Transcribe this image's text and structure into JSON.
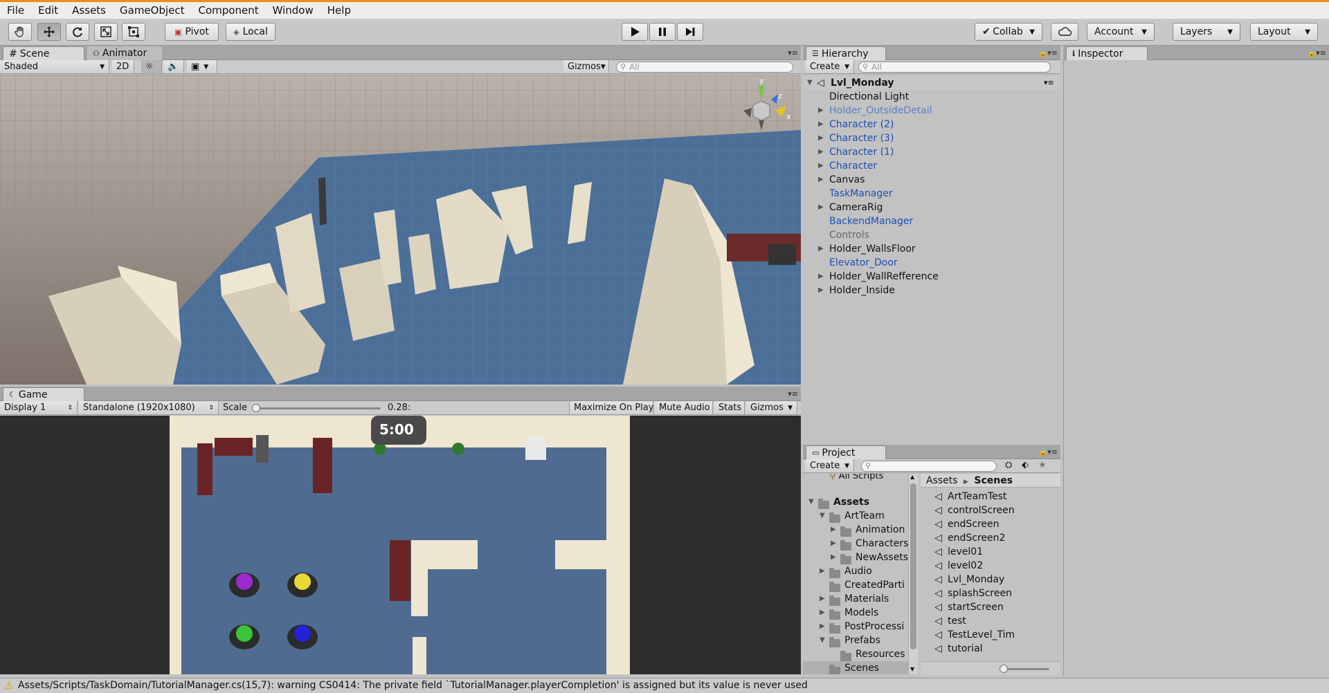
{
  "menu": [
    "File",
    "Edit",
    "Assets",
    "GameObject",
    "Component",
    "Window",
    "Help"
  ],
  "toolbar": {
    "pivot": "Pivot",
    "local": "Local",
    "collab": "Collab",
    "account": "Account",
    "layers": "Layers",
    "layout": "Layout"
  },
  "scene": {
    "tab": "Scene",
    "animator_tab": "Animator",
    "shading": "Shaded",
    "mode_2d": "2D",
    "gizmos": "Gizmos",
    "search_placeholder": "All",
    "axis_y": "y",
    "axis_z": "z",
    "axis_x": "x"
  },
  "game": {
    "tab": "Game",
    "display": "Display 1",
    "resolution": "Standalone (1920x1080)",
    "scale_label": "Scale",
    "scale_value": "0.28:",
    "scale_level": 0.0,
    "maximize": "Maximize On Play",
    "mute": "Mute Audio",
    "stats": "Stats",
    "gizmos": "Gizmos",
    "timer": "5:00"
  },
  "hierarchy": {
    "tab": "Hierarchy",
    "create": "Create",
    "search_placeholder": "All",
    "root": "Lvl_Monday",
    "items": [
      {
        "label": "Directional Light",
        "expandable": false,
        "color": "black"
      },
      {
        "label": "Holder_OutsideDetail",
        "expandable": true,
        "color": "lightblue"
      },
      {
        "label": "Character (2)",
        "expandable": true,
        "color": "blue"
      },
      {
        "label": "Character (3)",
        "expandable": true,
        "color": "blue"
      },
      {
        "label": "Character (1)",
        "expandable": true,
        "color": "blue"
      },
      {
        "label": "Character",
        "expandable": true,
        "color": "blue"
      },
      {
        "label": "Canvas",
        "expandable": true,
        "color": "black"
      },
      {
        "label": "TaskManager",
        "expandable": false,
        "color": "blue"
      },
      {
        "label": "CameraRig",
        "expandable": true,
        "color": "black"
      },
      {
        "label": "BackendManager",
        "expandable": false,
        "color": "blue"
      },
      {
        "label": "Controls",
        "expandable": false,
        "color": "gray"
      },
      {
        "label": "Holder_WallsFloor",
        "expandable": true,
        "color": "black"
      },
      {
        "label": "Elevator_Door",
        "expandable": false,
        "color": "blue"
      },
      {
        "label": "Holder_WallRefference",
        "expandable": true,
        "color": "black"
      },
      {
        "label": "Holder_Inside",
        "expandable": true,
        "color": "black"
      }
    ]
  },
  "inspector": {
    "tab": "Inspector"
  },
  "project": {
    "tab": "Project",
    "create": "Create",
    "favorites_item": "All Scripts",
    "tree": [
      {
        "label": "Assets",
        "depth": 0,
        "arrow": "open",
        "bold": true
      },
      {
        "label": "ArtTeam",
        "depth": 1,
        "arrow": "open",
        "bold": false
      },
      {
        "label": "Animation",
        "depth": 2,
        "arrow": "closed",
        "bold": false
      },
      {
        "label": "Characters",
        "depth": 2,
        "arrow": "closed",
        "bold": false
      },
      {
        "label": "NewAssets",
        "depth": 2,
        "arrow": "closed",
        "bold": false
      },
      {
        "label": "Audio",
        "depth": 1,
        "arrow": "closed",
        "bold": false
      },
      {
        "label": "CreatedParti",
        "depth": 1,
        "arrow": "none",
        "bold": false
      },
      {
        "label": "Materials",
        "depth": 1,
        "arrow": "closed",
        "bold": false
      },
      {
        "label": "Models",
        "depth": 1,
        "arrow": "closed",
        "bold": false
      },
      {
        "label": "PostProcessi",
        "depth": 1,
        "arrow": "closed",
        "bold": false
      },
      {
        "label": "Prefabs",
        "depth": 1,
        "arrow": "open",
        "bold": false
      },
      {
        "label": "Resources",
        "depth": 2,
        "arrow": "none",
        "bold": false
      },
      {
        "label": "Scenes",
        "depth": 1,
        "arrow": "none",
        "bold": false,
        "selected": true
      }
    ],
    "breadcrumb": [
      "Assets",
      "Scenes"
    ],
    "files": [
      "ArtTeamTest",
      "controlScreen",
      "endScreen",
      "endScreen2",
      "level01",
      "level02",
      "Lvl_Monday",
      "splashScreen",
      "startScreen",
      "test",
      "TestLevel_Tim",
      "tutorial"
    ],
    "zoom_level": 0.0
  },
  "status": {
    "message": "Assets/Scripts/TaskDomain/TutorialManager.cs(15,7): warning CS0414: The private field `TutorialManager.playerCompletion' is assigned but its value is never used"
  },
  "colors": {
    "accent": "#f08c1c",
    "link_blue": "#1d4fb0",
    "prefab_light_blue": "#5a7fc2",
    "floor_blue": "#4a6d97",
    "wall_cream": "#ece2cc"
  }
}
